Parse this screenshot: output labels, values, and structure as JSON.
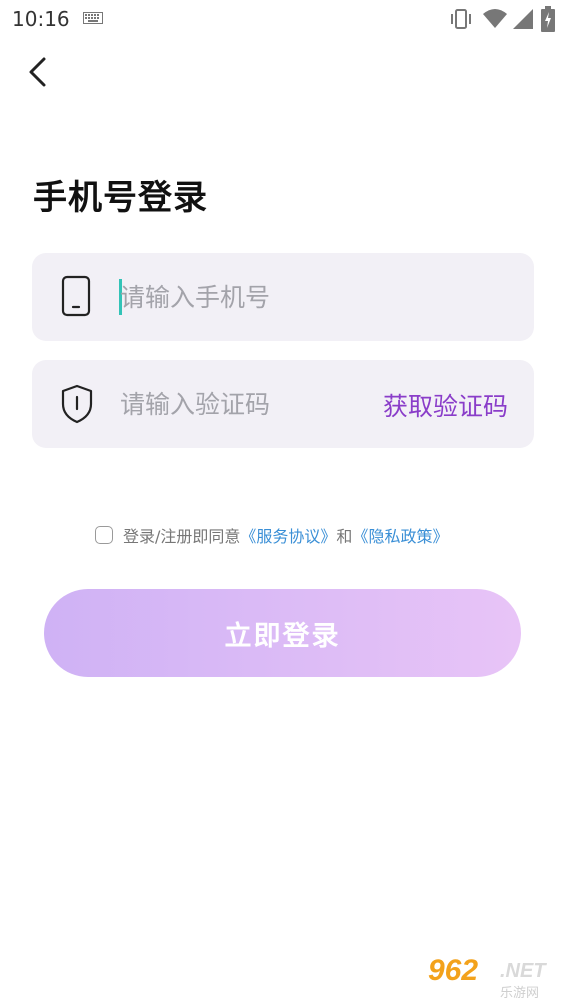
{
  "status_bar": {
    "time": "10:16",
    "icons": [
      "keyboard-icon",
      "vibrate-icon",
      "wifi-icon",
      "signal-icon",
      "battery-icon"
    ]
  },
  "header": {
    "back_icon": "chevron-left-icon"
  },
  "title": "手机号登录",
  "phone_field": {
    "icon": "phone-icon",
    "placeholder": "请输入手机号",
    "value": ""
  },
  "code_field": {
    "icon": "shield-icon",
    "placeholder": "请输入验证码",
    "value": "",
    "get_code_label": "获取验证码"
  },
  "agreement": {
    "checked": false,
    "prefix": "登录/注册即同意",
    "service_link": "《服务协议》",
    "and": "和",
    "privacy_link": "《隐私政策》"
  },
  "login_button": {
    "label": "立即登录"
  },
  "watermark": {
    "main": "962",
    "net": ".NET",
    "sub": "乐游网"
  },
  "colors": {
    "accent": "#8a3dc9",
    "link": "#3a8fd6",
    "caret": "#33c3b7",
    "field_bg": "#f2f0f6",
    "button_gradient_start": "#cfb2f5",
    "button_gradient_end": "#e8c4f7"
  }
}
